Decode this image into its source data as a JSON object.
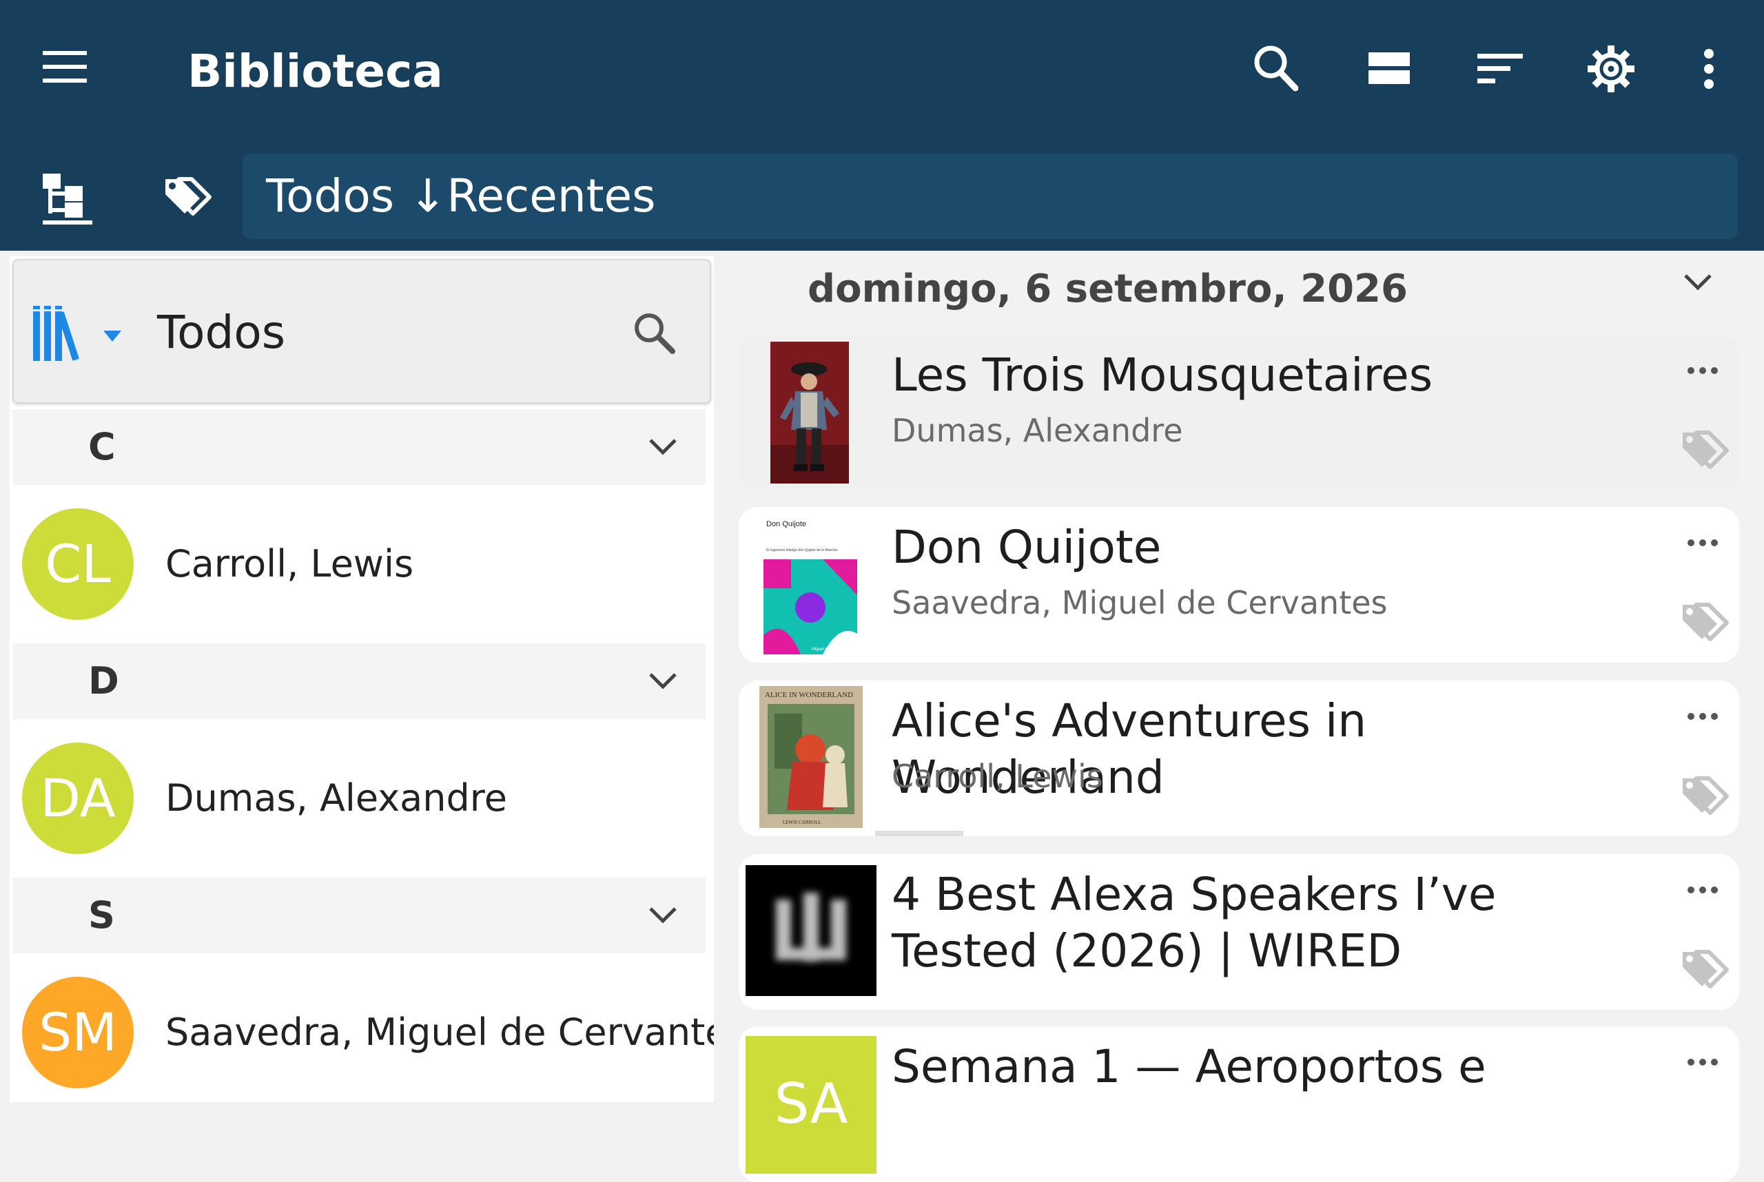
{
  "appbar": {
    "title": "Biblioteca",
    "filter": "Todos ↓Recentes",
    "background_color": "#173f5c"
  },
  "left_pane": {
    "header_title": "Todos",
    "sections": [
      {
        "letter": "C",
        "authors": [
          {
            "initials": "CL",
            "name": "Carroll, Lewis",
            "color": "#cddc39"
          }
        ]
      },
      {
        "letter": "D",
        "authors": [
          {
            "initials": "DA",
            "name": "Dumas, Alexandre",
            "color": "#cddc39"
          }
        ]
      },
      {
        "letter": "S",
        "authors": [
          {
            "initials": "SM",
            "name": "Saavedra, Miguel de Cervantes",
            "color": "#ffa726"
          }
        ]
      }
    ]
  },
  "right_pane": {
    "date_heading": "domingo, 6 setembro, 2026",
    "books": [
      {
        "title": "Les Trois Mousquetaires",
        "author": "Dumas, Alexandre",
        "selected": true
      },
      {
        "title": "Don Quijote",
        "author": "Saavedra, Miguel de Cervantes",
        "cover_title": "Don Quijote",
        "cover_subtitle": "El ingenioso hidalgo don Quijote de la Mancha",
        "cover_footer": "Miguel de Cervantes"
      },
      {
        "title": "Alice's Adventures in Wonderland",
        "author": "Carroll, Lewis",
        "cover_title": "ALICE IN WONDERLAND",
        "cover_footer": "LEWIS CARROLL"
      },
      {
        "title": "4 Best Alexa Speakers I’ve Tested (2026) | WIRED",
        "author": ""
      },
      {
        "title": "Semana 1 — Aeroportos e",
        "author": "",
        "cover_initials": "SA"
      }
    ]
  },
  "icons": {
    "menu": "menu-icon",
    "search": "search-icon",
    "view": "view-list-icon",
    "sort": "sort-icon",
    "settings": "gear-icon",
    "more": "more-vert-icon",
    "tree": "tree-view-icon",
    "tags": "tags-icon",
    "library": "library-books-icon"
  },
  "colors": {
    "accent_blue": "#1e88e5",
    "card_selected": "#f0f0f0"
  }
}
